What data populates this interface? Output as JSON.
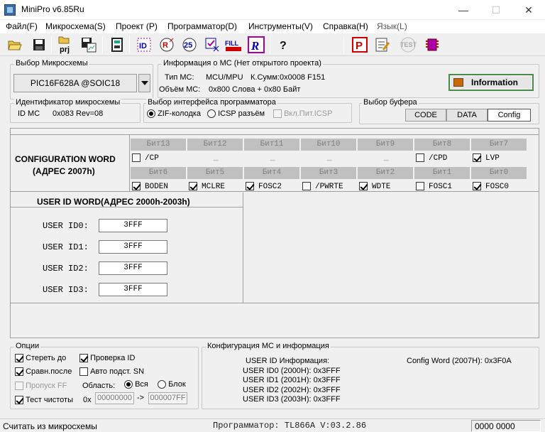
{
  "window": {
    "title": "MiniPro v6.85Ru",
    "min": "—",
    "max": "☐",
    "close": "✕"
  },
  "menu": [
    "Файл(F)",
    "Микросхема(S)",
    "Проект (P)",
    "Программатор(D)",
    "Инструменты(V)",
    "Справка(H)",
    "Язык(L)"
  ],
  "toolbar": {
    "prj_label": "prj",
    "fill_label": "FILL",
    "id_label": "ID",
    "num25": "25",
    "r_label": "R",
    "test_label": "TEST",
    "p_label": "P",
    "help": "?"
  },
  "chip": {
    "group": "Выбор Микросхемы",
    "value": "PIC16F628A @SOIC18"
  },
  "info": {
    "group": "Информация о МС (Нет открытого проекта)",
    "type_label": "Тип МС:",
    "type_value": "MCU/MPU",
    "checksum": "К.Сумм:0x0008 F151",
    "volume_label": "Объём МС:",
    "volume_value": "0x800 Слова + 0x80 Байт",
    "button": "Information"
  },
  "ident": {
    "group": "Идентификатор микросхемы",
    "label": "ID МС",
    "value": "0x083 Rev=08"
  },
  "iface": {
    "group": "Выбор интерфейса программатора",
    "zif": "ZIF-колодка",
    "icsp": "ICSP разъём",
    "power": "Вкл.Пит.ICSP"
  },
  "buffer": {
    "group": "Выбор буфера",
    "code": "CODE",
    "data": "DATA",
    "config": "Config"
  },
  "config": {
    "title": "CONFIGURATION WORD",
    "addr": "(АДРЕС   2007h)",
    "row1_bits": [
      "Бит13",
      "Бит12",
      "Бит11",
      "Бит10",
      "Бит9",
      "Бит8",
      "Бит7"
    ],
    "row1_vals": [
      {
        "t": "/CP",
        "c": false,
        "cb": true
      },
      {
        "t": "_",
        "cb": false
      },
      {
        "t": "_",
        "cb": false
      },
      {
        "t": "_",
        "cb": false
      },
      {
        "t": "_",
        "cb": false
      },
      {
        "t": "/CPD",
        "c": false,
        "cb": true
      },
      {
        "t": "LVP",
        "c": true,
        "cb": true
      }
    ],
    "row2_bits": [
      "Бит6",
      "Бит5",
      "Бит4",
      "Бит3",
      "Бит2",
      "Бит1",
      "Бит0"
    ],
    "row2_vals": [
      {
        "t": "BODEN",
        "c": true
      },
      {
        "t": "MCLRE",
        "c": true
      },
      {
        "t": "FOSC2",
        "c": true
      },
      {
        "t": "/PWRTE",
        "c": false
      },
      {
        "t": "WDTE",
        "c": true
      },
      {
        "t": "FOSC1",
        "c": false
      },
      {
        "t": "FOSC0",
        "c": true
      }
    ]
  },
  "userid": {
    "title": "USER ID WORD(АДРЕС   2000h-2003h)",
    "items": [
      {
        "label": "USER ID0:",
        "value": "3FFF"
      },
      {
        "label": "USER ID1:",
        "value": "3FFF"
      },
      {
        "label": "USER ID2:",
        "value": "3FFF"
      },
      {
        "label": "USER ID3:",
        "value": "3FFF"
      }
    ]
  },
  "options": {
    "group": "Опции",
    "erase": "Стереть до",
    "verify_id": "Проверка ID",
    "compare": "Сравн.после",
    "auto_sn": "Авто подст. SN",
    "skip_ff": "Пропуск FF",
    "area": "Область:",
    "all": "Вся",
    "block": "Блок",
    "blank": "Тест чистоты",
    "hex": "0x",
    "from": "00000000",
    "arrow": "->",
    "to": "000007FF"
  },
  "confinfo": {
    "group": "Конфигурация МС и информация",
    "lines": [
      "USER ID Информация:",
      "USER ID0 (2000H): 0x3FFF",
      "USER ID1 (2001H): 0x3FFF",
      "USER ID2 (2002H): 0x3FFF",
      "USER ID3 (2003H): 0x3FFF"
    ],
    "cfg": "Config Word (2007H): 0x3F0A"
  },
  "status": {
    "left": "Считать из микросхемы",
    "center": "Программатор: TL866A V:03.2.86",
    "right": "0000 0000"
  }
}
